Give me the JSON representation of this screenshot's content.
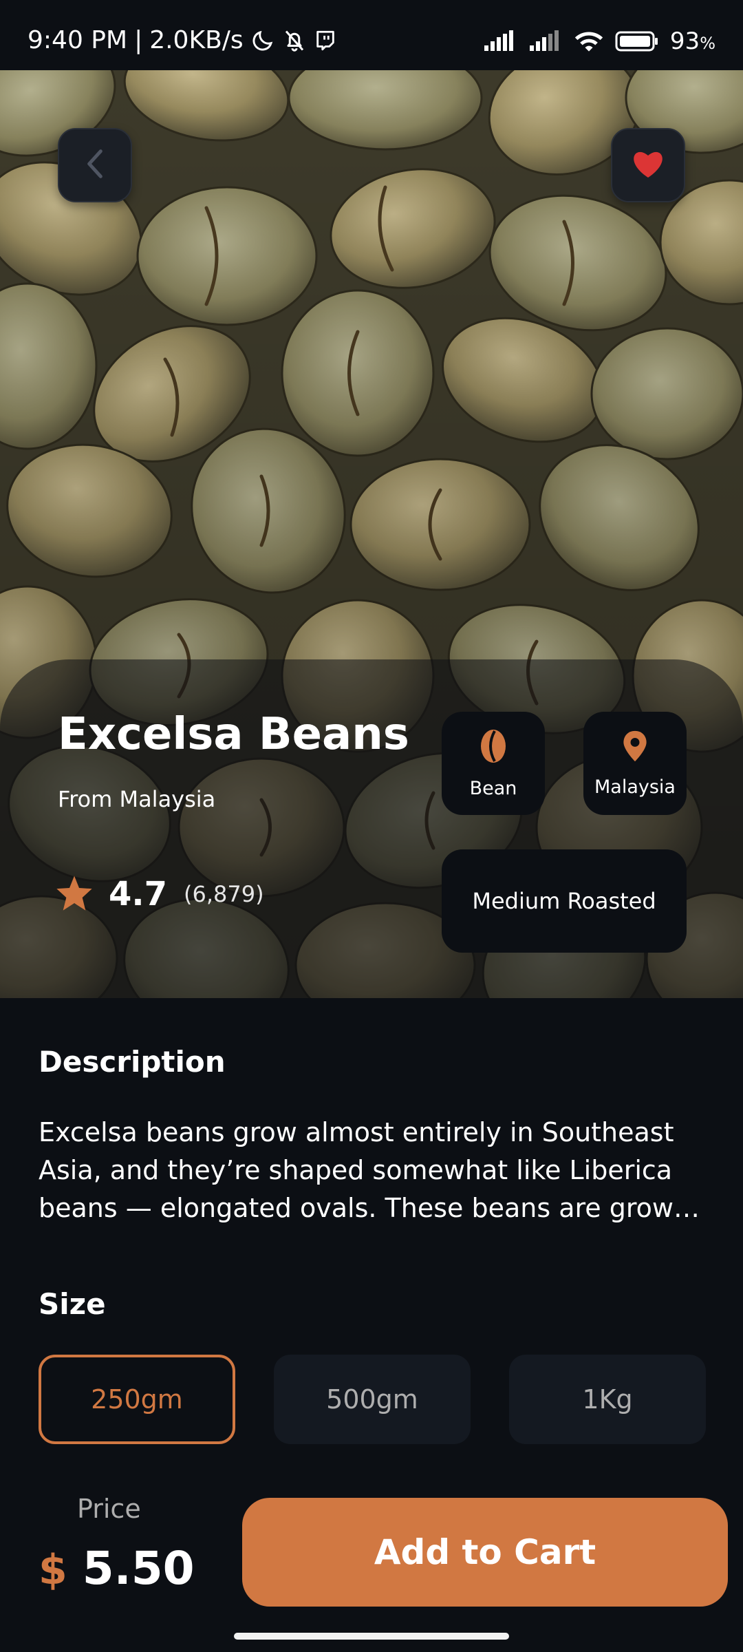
{
  "status_bar": {
    "time": "9:40 PM",
    "speed": "2.0KB/s",
    "battery": "93",
    "battery_unit": "%",
    "icons": [
      "moon-icon",
      "bell-off-icon",
      "twitch-icon",
      "signal-icon",
      "signal-icon",
      "wifi-icon",
      "battery-icon"
    ]
  },
  "header": {
    "icons": [
      "chevron-left-icon",
      "heart-icon"
    ]
  },
  "product": {
    "name": "Excelsa Beans",
    "origin": "From Malaysia",
    "rating": "4.7",
    "rating_count": "(6,879)",
    "tags": {
      "type_label": "Bean",
      "type_icon": "bean-icon",
      "location_label": "Malaysia",
      "location_icon": "location-pin-icon"
    },
    "roast": "Medium Roasted"
  },
  "description": {
    "title": "Description",
    "text": "Excelsa beans grow almost entirely in Southeast Asia, and they’re shaped somewhat like Liberica beans — elongated ovals. These beans are grown on large trees in similar altitudes as Liberica and have a distinctive tart, fruity taste."
  },
  "size": {
    "title": "Size",
    "options": [
      "250gm",
      "500gm",
      "1Kg"
    ],
    "selected": "250gm"
  },
  "footer": {
    "price_label": "Price",
    "currency": "$",
    "price": "5.50",
    "cta_label": "Add to Cart"
  },
  "colors": {
    "background": "#0c0f14",
    "accent": "#d17842",
    "card": "#141921",
    "muted_text": "#aeaeae",
    "heart": "#dc3535"
  }
}
